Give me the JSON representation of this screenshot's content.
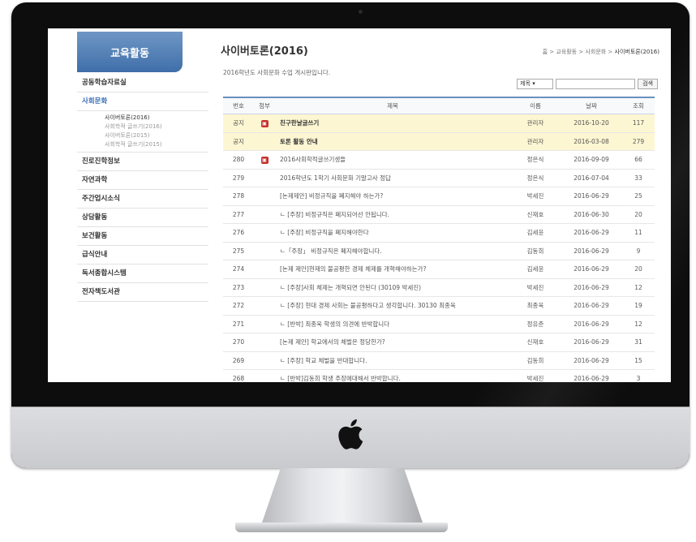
{
  "sidebar": {
    "header": "교육활동",
    "items": [
      {
        "label": "공동학습자료실",
        "active": false
      },
      {
        "label": "사회문화",
        "active": true
      },
      {
        "label": "진로진학정보",
        "active": false
      },
      {
        "label": "자연과학",
        "active": false
      },
      {
        "label": "주간업시소식",
        "active": false
      },
      {
        "label": "상담활동",
        "active": false
      },
      {
        "label": "보건활동",
        "active": false
      },
      {
        "label": "급식안내",
        "active": false
      },
      {
        "label": "독서종합시스템",
        "active": false
      },
      {
        "label": "전자책도서관",
        "active": false
      }
    ],
    "subitems": [
      {
        "label": "사이버토론(2016)",
        "current": true
      },
      {
        "label": "사회학적 글쓰기(2016)",
        "current": false
      },
      {
        "label": "사이버토론(2015)",
        "current": false
      },
      {
        "label": "사회학적 글쓰기(2015)",
        "current": false
      }
    ]
  },
  "page": {
    "title": "사이버토론(2016)",
    "breadcrumb_path": "홈 > 교육활동 > 사회문화 > ",
    "breadcrumb_current": "사이버토론(2016)",
    "description": "2016학년도 사회문화 수업 게시판입니다."
  },
  "search": {
    "select_value": "제목",
    "button_label": "검색"
  },
  "table": {
    "headers": [
      "번호",
      "첨부",
      "제목",
      "이름",
      "날짜",
      "조회"
    ],
    "rows": [
      {
        "num": "공지",
        "attach": "▣",
        "subject": "친구한날글쓰기",
        "name": "관리자",
        "date": "2016-10-20",
        "hits": "117",
        "notice": true,
        "bold": true
      },
      {
        "num": "공지",
        "attach": "",
        "subject": "토론 활동 안내",
        "name": "관리자",
        "date": "2016-03-08",
        "hits": "279",
        "notice": true,
        "bold": true
      },
      {
        "num": "280",
        "attach": "▣",
        "subject": "2016사회학적글쓰기생들",
        "name": "정은식",
        "date": "2016-09-09",
        "hits": "66",
        "notice": false,
        "bold": false
      },
      {
        "num": "279",
        "attach": "",
        "subject": "2016학년도 1학기 사회문화 기말고사 정답",
        "name": "정은식",
        "date": "2016-07-04",
        "hits": "33",
        "notice": false,
        "bold": false
      },
      {
        "num": "278",
        "attach": "",
        "subject": "[논제제안] 비정규직을 폐지해야 하는가?",
        "name": "박세진",
        "date": "2016-06-29",
        "hits": "25",
        "notice": false,
        "bold": false
      },
      {
        "num": "277",
        "attach": "",
        "subject": "ㄴ [주장] 비정규직은 폐지되어선 안됩니다.",
        "name": "신재호",
        "date": "2016-06-30",
        "hits": "20",
        "notice": false,
        "bold": false
      },
      {
        "num": "276",
        "attach": "",
        "subject": "ㄴ [주장] 비정규직을 폐지해야한다",
        "name": "김세윤",
        "date": "2016-06-29",
        "hits": "11",
        "notice": false,
        "bold": false
      },
      {
        "num": "275",
        "attach": "",
        "subject": "ㄴ「주장」 비정규직은 폐지해야합니다.",
        "name": "김동희",
        "date": "2016-06-29",
        "hits": "9",
        "notice": false,
        "bold": false
      },
      {
        "num": "274",
        "attach": "",
        "subject": "[논제 제안]현재의 불공평한 경제 체제를 개혁해야하는가?",
        "name": "김세윤",
        "date": "2016-06-29",
        "hits": "20",
        "notice": false,
        "bold": false
      },
      {
        "num": "273",
        "attach": "",
        "subject": "ㄴ [주장]사회 체제는 개혁되면 안된다 (30109 박세진)",
        "name": "박세진",
        "date": "2016-06-29",
        "hits": "12",
        "notice": false,
        "bold": false
      },
      {
        "num": "272",
        "attach": "",
        "subject": "ㄴ [주장] 현대 경제 사회는 불공평하다고 생각합니다. 30130 최종욱",
        "name": "최종욱",
        "date": "2016-06-29",
        "hits": "19",
        "notice": false,
        "bold": false
      },
      {
        "num": "271",
        "attach": "",
        "subject": "ㄴ [반박] 최종욱 학생의 의견에 반박합니다",
        "name": "정유준",
        "date": "2016-06-29",
        "hits": "12",
        "notice": false,
        "bold": false
      },
      {
        "num": "270",
        "attach": "",
        "subject": "[논제 제안] 학교에서의 체벌은 정당한가?",
        "name": "신재호",
        "date": "2016-06-29",
        "hits": "31",
        "notice": false,
        "bold": false
      },
      {
        "num": "269",
        "attach": "",
        "subject": "ㄴ [주장] 학교 체벌을 반대합니다.",
        "name": "김동희",
        "date": "2016-06-29",
        "hits": "15",
        "notice": false,
        "bold": false
      },
      {
        "num": "268",
        "attach": "",
        "subject": "ㄴ [반박]김동희 학생 주장에대해서 반박합니다.",
        "name": "박세진",
        "date": "2016-06-29",
        "hits": "3",
        "notice": false,
        "bold": false
      }
    ]
  }
}
